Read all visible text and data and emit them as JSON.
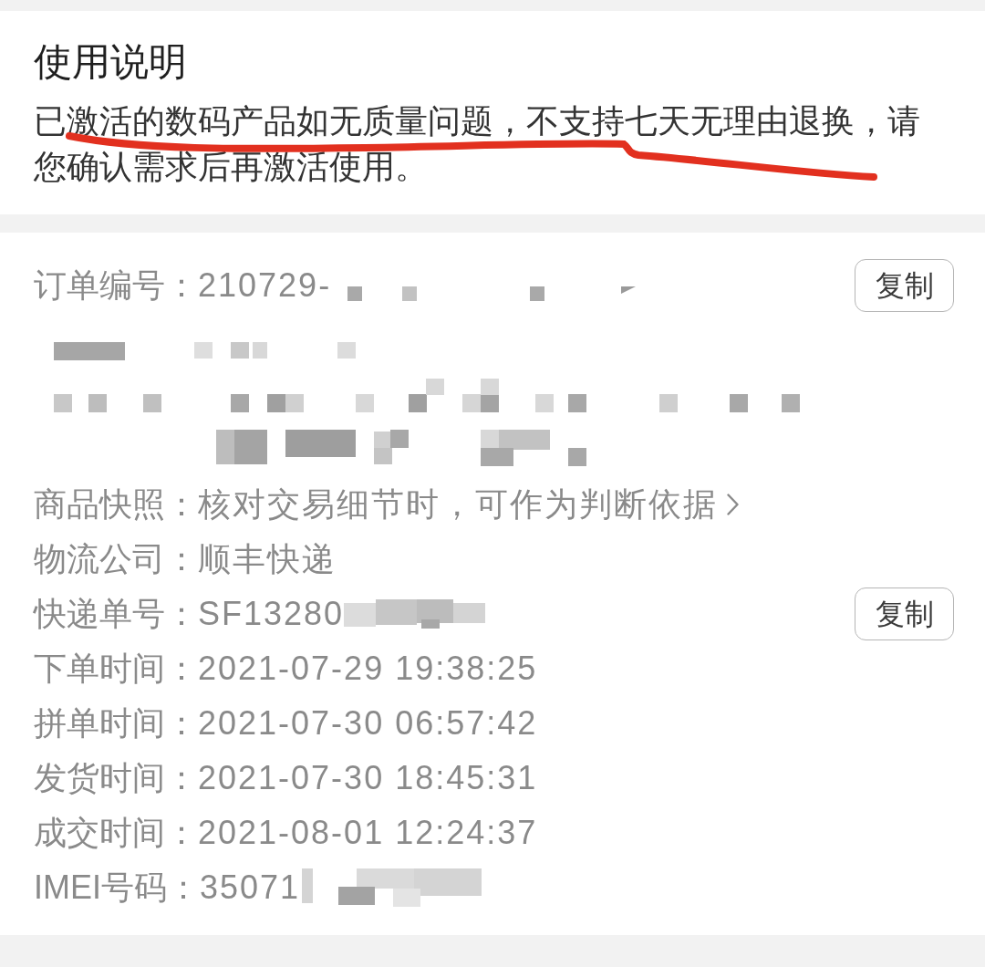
{
  "notice": {
    "title": "使用说明",
    "text": "已激活的数码产品如无质量问题，不支持七天无理由退换，请您确认需求后再激活使用。",
    "underlined": true
  },
  "order_details": {
    "rows": [
      {
        "kind": "field",
        "label": "订单编号：",
        "value": "210729-",
        "redacted": true,
        "copy_button": "复制"
      },
      {
        "kind": "redacted"
      },
      {
        "kind": "link",
        "label": "商品快照：",
        "value": "核对交易细节时，可作为判断依据"
      },
      {
        "kind": "field",
        "label": "物流公司：",
        "value": "顺丰快递",
        "redacted": false
      },
      {
        "kind": "field",
        "label": "快递单号：",
        "value": "SF13280",
        "redacted": true,
        "copy_button": "复制"
      },
      {
        "kind": "field",
        "label": "下单时间：",
        "value": "2021-07-29 19:38:25",
        "redacted": false
      },
      {
        "kind": "field",
        "label": "拼单时间：",
        "value": "2021-07-30 06:57:42",
        "redacted": false
      },
      {
        "kind": "field",
        "label": "发货时间：",
        "value": "2021-07-30 18:45:31",
        "redacted": false
      },
      {
        "kind": "field",
        "label": "成交时间：",
        "value": "2021-08-01 12:24:37",
        "redacted": false
      },
      {
        "kind": "field",
        "label": "IMEI号码：",
        "value": "35071",
        "redacted": true
      }
    ]
  }
}
